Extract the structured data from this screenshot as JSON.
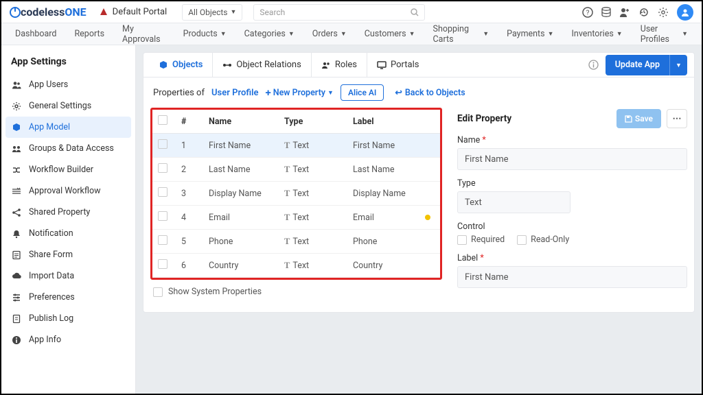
{
  "brand": {
    "prefix": "codeless",
    "suffix": "ONE"
  },
  "portal_name": "Default Portal",
  "search": {
    "object_selector": "All Objects",
    "placeholder": "Search"
  },
  "menu": [
    "Dashboard",
    "Reports",
    "My Approvals",
    "Products",
    "Categories",
    "Orders",
    "Customers",
    "Shopping Carts",
    "Payments",
    "Inventories",
    "User Profiles"
  ],
  "menu_caret": [
    false,
    false,
    false,
    true,
    true,
    true,
    true,
    true,
    true,
    true,
    true
  ],
  "sidebar": {
    "title": "App Settings",
    "items": [
      {
        "label": "App Users",
        "icon": "users"
      },
      {
        "label": "General Settings",
        "icon": "gear"
      },
      {
        "label": "App Model",
        "icon": "cube",
        "active": true
      },
      {
        "label": "Groups & Data Access",
        "icon": "group"
      },
      {
        "label": "Workflow Builder",
        "icon": "flow"
      },
      {
        "label": "Approval Workflow",
        "icon": "check"
      },
      {
        "label": "Shared Property",
        "icon": "share"
      },
      {
        "label": "Notification",
        "icon": "bell"
      },
      {
        "label": "Share Form",
        "icon": "form"
      },
      {
        "label": "Import Data",
        "icon": "cloud"
      },
      {
        "label": "Preferences",
        "icon": "pref"
      },
      {
        "label": "Publish Log",
        "icon": "log"
      },
      {
        "label": "App Info",
        "icon": "info"
      }
    ]
  },
  "tabs": [
    "Objects",
    "Object Relations",
    "Roles",
    "Portals"
  ],
  "update_label": "Update App",
  "properties": {
    "prefix": "Properties of",
    "object": "User Profile",
    "new_property": "New Property",
    "alice": "Alice AI",
    "back": "Back to Objects"
  },
  "table": {
    "headers": [
      "#",
      "Name",
      "Type",
      "Label"
    ],
    "rows": [
      {
        "n": "1",
        "name": "First Name",
        "type": "Text",
        "label": "First Name",
        "selected": true
      },
      {
        "n": "2",
        "name": "Last Name",
        "type": "Text",
        "label": "Last Name"
      },
      {
        "n": "3",
        "name": "Display Name",
        "type": "Text",
        "label": "Display Name"
      },
      {
        "n": "4",
        "name": "Email",
        "type": "Text",
        "label": "Email",
        "dot": true
      },
      {
        "n": "5",
        "name": "Phone",
        "type": "Text",
        "label": "Phone"
      },
      {
        "n": "6",
        "name": "Country",
        "type": "Text",
        "label": "Country"
      }
    ],
    "show_system": "Show System Properties"
  },
  "edit": {
    "title": "Edit Property",
    "save": "Save",
    "name_label": "Name",
    "name_value": "First Name",
    "type_label": "Type",
    "type_value": "Text",
    "control_label": "Control",
    "required": "Required",
    "readonly": "Read-Only",
    "label_label": "Label",
    "label_value": "First Name"
  }
}
